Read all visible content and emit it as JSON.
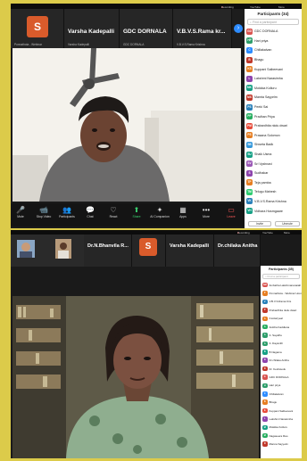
{
  "top": {
    "window_bar": {
      "recording": "Recording",
      "youtube": "YouTube",
      "more": "More"
    },
    "tiles": [
      {
        "name": "",
        "sub": "Ponnathota - Webinar",
        "avatar": "S"
      },
      {
        "name": "Varsha Kadepalli",
        "sub": "Varsha Kadepalli"
      },
      {
        "name": "GDC DORNALA",
        "sub": "GDC DORNALA"
      },
      {
        "name": "V.B.V.S.Rama kr...",
        "sub": "V.B.V.S.Rama Krishna"
      }
    ],
    "toolbar": [
      {
        "icon": "🎤",
        "label": "Mute"
      },
      {
        "icon": "📹",
        "label": "Stop Video"
      },
      {
        "icon": "👥",
        "label": "Participants"
      },
      {
        "icon": "💬",
        "label": "Chat"
      },
      {
        "icon": "♡",
        "label": "React"
      },
      {
        "icon": "⬆",
        "label": "Share"
      },
      {
        "icon": "✦",
        "label": "AI Companion"
      },
      {
        "icon": "▦",
        "label": "Apps"
      },
      {
        "icon": "•••",
        "label": "More"
      },
      {
        "icon": "▭",
        "label": "Leave"
      }
    ],
    "participants": {
      "title": "Participants (34)",
      "search_placeholder": "Find a participant",
      "items": [
        {
          "initials": "GD",
          "name": "GDC DORNALA",
          "color": "#d9534f"
        },
        {
          "initials": "HP",
          "name": "Hari priya",
          "color": "#2e9e6b"
        },
        {
          "initials": "C",
          "name": "Chillakalvan",
          "color": "#2d8cff"
        },
        {
          "initials": "B",
          "name": "Bhagu",
          "color": "#c0392b"
        },
        {
          "initials": "KS",
          "name": "Kuppani Saibeevani",
          "color": "#e67e22"
        },
        {
          "initials": "L",
          "name": "Lakshmi Narasimha",
          "color": "#8e44ad"
        },
        {
          "initials": "MK",
          "name": "Mokkka Kolluru",
          "color": "#16a085"
        },
        {
          "initials": "MS",
          "name": "Mamta Sayyelm",
          "color": "#c0392b"
        },
        {
          "initials": "PS",
          "name": "Peeki Sai",
          "color": "#2980b9"
        },
        {
          "initials": "PP",
          "name": "Pradhan Priya",
          "color": "#27ae60"
        },
        {
          "initials": "PM",
          "name": "Prabardhita nkdu dwari",
          "color": "#e74c3c"
        },
        {
          "initials": "PS",
          "name": "Prasana Solomon",
          "color": "#e67e22"
        },
        {
          "initials": "SB",
          "name": "Shweta Badk",
          "color": "#3498db"
        },
        {
          "initials": "SU",
          "name": "Shaik Usma",
          "color": "#16a085"
        },
        {
          "initials": "SV",
          "name": "Sri Vyshnavi",
          "color": "#9b59b6"
        },
        {
          "initials": "S",
          "name": "Sudhakar",
          "color": "#8e44ad"
        },
        {
          "initials": "TP",
          "name": "Teja pamba",
          "color": "#e67e22"
        },
        {
          "initials": "TM",
          "name": "Telugu Mahesh",
          "color": "#2ecc71"
        },
        {
          "initials": "VK",
          "name": "V.B.V.S.Rama Krishna",
          "color": "#2980b9"
        },
        {
          "initials": "VH",
          "name": "Vidhara Hosmgaare",
          "color": "#16a085"
        }
      ],
      "invite": "Invite",
      "unmute": "Unmute"
    }
  },
  "bottom": {
    "window_bar": {
      "recording": "Recording",
      "youtube": "YouTube",
      "more": "More"
    },
    "tiles": [
      {
        "name": "",
        "sub": "",
        "kind": "photo"
      },
      {
        "name": "",
        "sub": "",
        "kind": "photo2"
      },
      {
        "name": "Dr.N.Bhanvila R...",
        "sub": "Dr.N.Bhanvila Reddy"
      },
      {
        "name": "",
        "sub": "",
        "avatar": "S"
      },
      {
        "name": "Varsha Kadepalli",
        "sub": "Varsha Kadepalli"
      },
      {
        "name": "Dr.chilaka Anitha",
        "sub": "Dr.chilaka Anitha"
      }
    ],
    "participants": {
      "title": "Participants (35)",
      "search_placeholder": "Find a participant",
      "items": [
        {
          "initials": "AM",
          "name": "Ambatha Lakshmananaiah Pl",
          "color": "#d9534f"
        },
        {
          "initials": "P",
          "name": "Ponnathota - Webinar Host",
          "color": "#e67e22"
        },
        {
          "initials": "V",
          "name": "V.B.V.S.Rama Kris",
          "color": "#2980b9"
        },
        {
          "initials": "P",
          "name": "Prabardhita nkdu dwari",
          "color": "#c0392b"
        },
        {
          "initials": "A",
          "name": "A kolariyeal",
          "color": "#e67e22"
        },
        {
          "initials": "A",
          "name": "Ankiha Kaddiana",
          "color": "#27ae60"
        },
        {
          "initials": "A",
          "name": "A. Sayalhu",
          "color": "#2e9e6b"
        },
        {
          "initials": "A",
          "name": "A. Dayanith",
          "color": "#2e9e6b"
        },
        {
          "initials": "B",
          "name": "B Nagama",
          "color": "#16a085"
        },
        {
          "initials": "D",
          "name": "Dr.chilaka Anitha",
          "color": "#8e44ad"
        },
        {
          "initials": "D",
          "name": "Dr. Keshavulu",
          "color": "#c0392b"
        },
        {
          "initials": "G",
          "name": "GDC DORNALA",
          "color": "#d9534f"
        },
        {
          "initials": "H",
          "name": "Hari priya",
          "color": "#2e9e6b"
        },
        {
          "initials": "C",
          "name": "Chillakalvan",
          "color": "#2d8cff"
        },
        {
          "initials": "B",
          "name": "Bhagu",
          "color": "#e67e22"
        },
        {
          "initials": "K",
          "name": "Kuppani Saibeevani",
          "color": "#e74c3c"
        },
        {
          "initials": "L",
          "name": "Lakshmi Narasimha",
          "color": "#8e44ad"
        },
        {
          "initials": "M",
          "name": "Mokkka Kolluru",
          "color": "#16a085"
        },
        {
          "initials": "M",
          "name": "Nagaseera Rao",
          "color": "#27ae60"
        },
        {
          "initials": "R",
          "name": "Manna Sayyelm",
          "color": "#c0392b"
        }
      ]
    }
  }
}
